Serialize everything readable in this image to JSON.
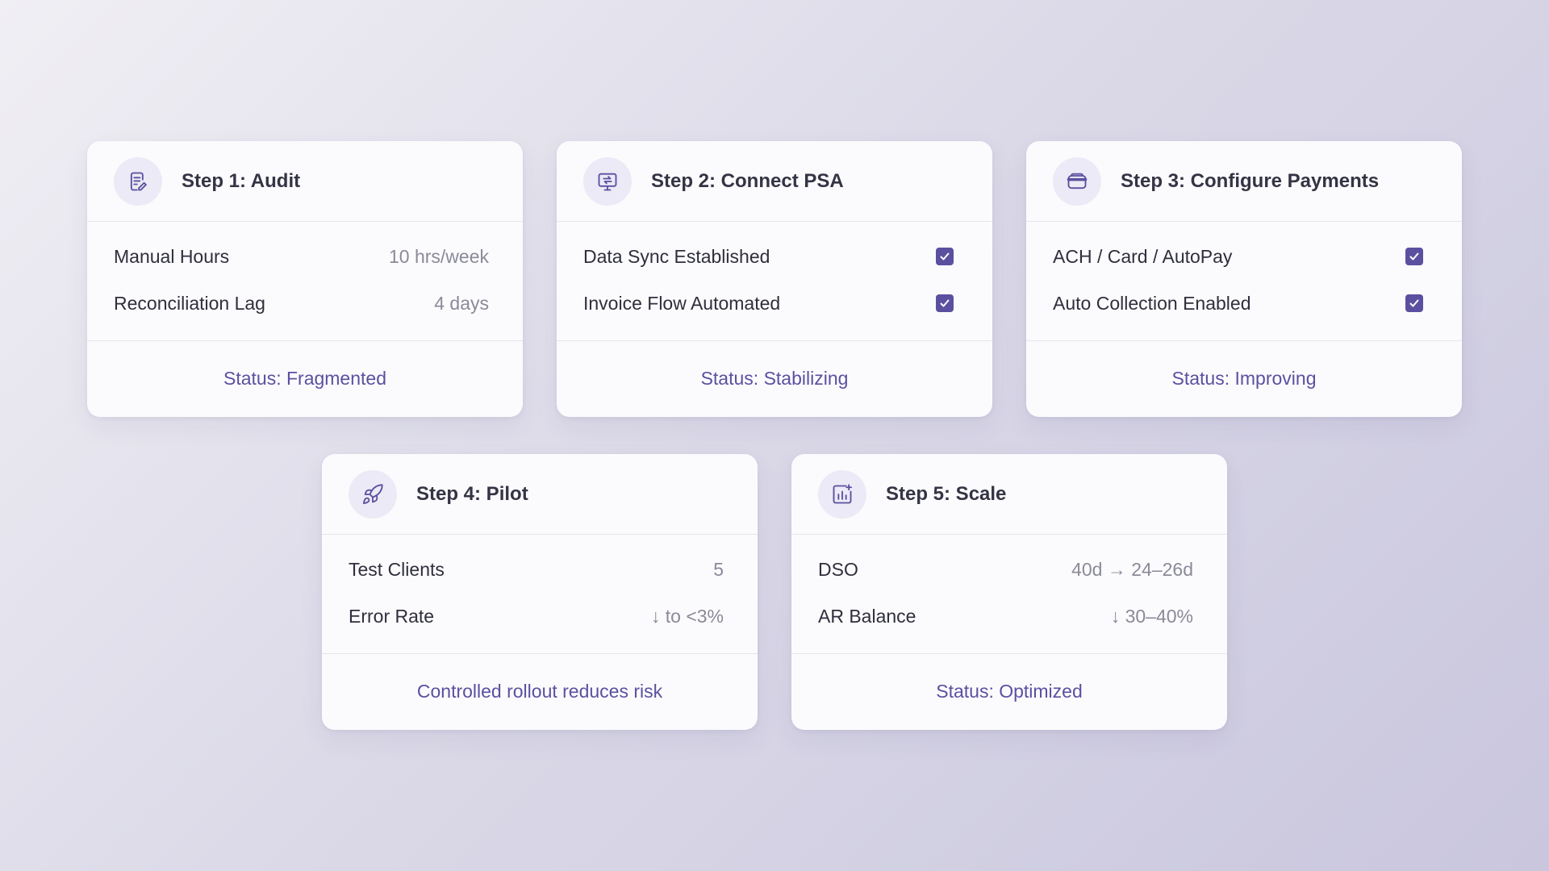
{
  "colors": {
    "accent": "#5b50a0",
    "card_bg": "#fbfbfd",
    "icon_bg": "#ebeaf6",
    "label": "#2f2f3d",
    "muted": "#8a8a99"
  },
  "cards": [
    {
      "icon": "document-edit-icon",
      "title": "Step 1: Audit",
      "rows": [
        {
          "label": "Manual Hours",
          "value": "10 hrs/week"
        },
        {
          "label": "Reconciliation Lag",
          "value": "4 days"
        }
      ],
      "footer": "Status: Fragmented"
    },
    {
      "icon": "monitor-sync-icon",
      "title": "Step 2: Connect PSA",
      "rows": [
        {
          "label": "Data Sync Established",
          "checked": true
        },
        {
          "label": "Invoice Flow Automated",
          "checked": true
        }
      ],
      "footer": "Status: Stabilizing"
    },
    {
      "icon": "wallet-icon",
      "title": "Step 3: Configure Payments",
      "rows": [
        {
          "label": "ACH / Card / AutoPay",
          "checked": true
        },
        {
          "label": "Auto Collection Enabled",
          "checked": true
        }
      ],
      "footer": "Status: Improving"
    },
    {
      "icon": "rocket-icon",
      "title": "Step 4: Pilot",
      "rows": [
        {
          "label": "Test Clients",
          "value": "5"
        },
        {
          "label": "Error Rate",
          "value": "↓ to <3%"
        }
      ],
      "footer": "Controlled rollout reduces risk"
    },
    {
      "icon": "bar-chart-icon",
      "title": "Step 5: Scale",
      "rows": [
        {
          "label": "DSO",
          "value": "40d → 24–26d"
        },
        {
          "label": "AR Balance",
          "value": "↓ 30–40%"
        }
      ],
      "footer": "Status: Optimized"
    }
  ]
}
